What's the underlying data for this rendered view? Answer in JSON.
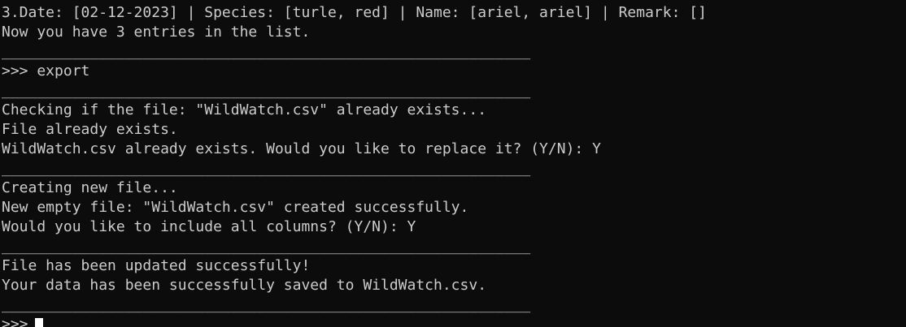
{
  "terminal": {
    "lines": [
      "3.Date: [02-12-2023] | Species: [turle, red] | Name: [ariel, ariel] | Remark: []",
      "Now you have 3 entries in the list.",
      "____________________________________________________________",
      ">>> export",
      "____________________________________________________________",
      "Checking if the file: \"WildWatch.csv\" already exists...",
      "File already exists.",
      "WildWatch.csv already exists. Would you like to replace it? (Y/N): Y",
      "____________________________________________________________",
      "Creating new file...",
      "New empty file: \"WildWatch.csv\" created successfully.",
      "Would you like to include all columns? (Y/N): Y",
      "____________________________________________________________",
      "File has been updated successfully!",
      "Your data has been successfully saved to WildWatch.csv.",
      "____________________________________________________________"
    ],
    "prompt": ">>>",
    "colors": {
      "background": "#0c0c0c",
      "text": "#cccccc",
      "cursor": "#ffffff"
    }
  }
}
